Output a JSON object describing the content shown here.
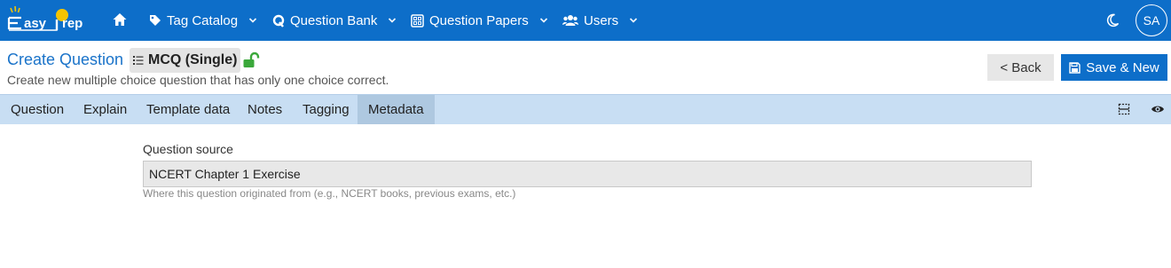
{
  "app": {
    "brand_name": "easyPrep"
  },
  "nav": {
    "items": [
      {
        "label": "Tag Catalog",
        "icon": "tag-icon"
      },
      {
        "label": "Question Bank",
        "icon": "q-icon"
      },
      {
        "label": "Question Papers",
        "icon": "paper-icon"
      },
      {
        "label": "Users",
        "icon": "users-icon"
      }
    ],
    "avatar_initials": "SA"
  },
  "header": {
    "title": "Create Question",
    "type_badge": "MCQ (Single)",
    "subtitle": "Create new multiple choice question that has only one choice correct.",
    "back_label": "< Back",
    "save_label": "Save & New"
  },
  "tabs": [
    {
      "label": "Question",
      "active": false
    },
    {
      "label": "Explain",
      "active": false
    },
    {
      "label": "Template data",
      "active": false
    },
    {
      "label": "Notes",
      "active": false
    },
    {
      "label": "Tagging",
      "active": false
    },
    {
      "label": "Metadata",
      "active": true
    }
  ],
  "form": {
    "source_label": "Question source",
    "source_value": "NCERT Chapter 1 Exercise",
    "source_help": "Where this question originated from (e.g., NCERT books, previous exams, etc.)"
  },
  "colors": {
    "primary": "#0d6ec9",
    "tabbar": "#c8def3",
    "active_tab": "#aec8e0",
    "lock_green": "#3aa83a",
    "logo_yellow": "#f5c400"
  }
}
